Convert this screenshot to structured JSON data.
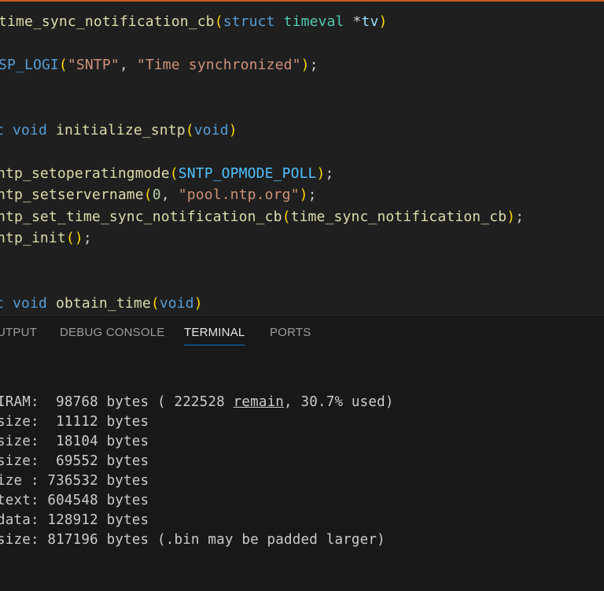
{
  "editor": {
    "lines": [
      {
        "parts": [
          {
            "t": "time_sync_notification_cb",
            "c": "tok-fn"
          },
          {
            "t": "(",
            "c": "tok-p1"
          },
          {
            "t": "struct",
            "c": "tok-kw"
          },
          {
            "t": " ",
            "c": "tok-punc"
          },
          {
            "t": "timeval",
            "c": "tok-type"
          },
          {
            "t": " *",
            "c": "tok-punc"
          },
          {
            "t": "tv",
            "c": "tok-var"
          },
          {
            "t": ")",
            "c": "tok-p1"
          }
        ]
      },
      {
        "parts": [
          {
            "t": "SP_LOGI",
            "c": "tok-kw"
          },
          {
            "t": "(",
            "c": "tok-p1"
          },
          {
            "t": "\"SNTP\"",
            "c": "tok-str"
          },
          {
            "t": ", ",
            "c": "tok-punc"
          },
          {
            "t": "\"Time synchronized\"",
            "c": "tok-str"
          },
          {
            "t": ")",
            "c": "tok-p1"
          },
          {
            "t": ";",
            "c": "tok-punc"
          }
        ]
      },
      {
        "parts": [
          {
            "t": "c",
            "c": "tok-kw"
          },
          {
            "t": " ",
            "c": "tok-punc"
          },
          {
            "t": "void",
            "c": "tok-kw"
          },
          {
            "t": " ",
            "c": "tok-punc"
          },
          {
            "t": "initialize_sntp",
            "c": "tok-fn"
          },
          {
            "t": "(",
            "c": "tok-p1"
          },
          {
            "t": "void",
            "c": "tok-kw"
          },
          {
            "t": ")",
            "c": "tok-p1"
          }
        ]
      },
      {
        "parts": [
          {
            "t": "ntp_setoperatingmode",
            "c": "tok-fn"
          },
          {
            "t": "(",
            "c": "tok-p1"
          },
          {
            "t": "SNTP_OPMODE_POLL",
            "c": "tok-const"
          },
          {
            "t": ")",
            "c": "tok-p1"
          },
          {
            "t": ";",
            "c": "tok-punc"
          }
        ]
      },
      {
        "parts": [
          {
            "t": "ntp_setservername",
            "c": "tok-fn"
          },
          {
            "t": "(",
            "c": "tok-p1"
          },
          {
            "t": "0",
            "c": "tok-num"
          },
          {
            "t": ", ",
            "c": "tok-punc"
          },
          {
            "t": "\"pool.ntp.org\"",
            "c": "tok-str"
          },
          {
            "t": ")",
            "c": "tok-p1"
          },
          {
            "t": ";",
            "c": "tok-punc"
          }
        ]
      },
      {
        "parts": [
          {
            "t": "ntp_set_time_sync_notification_cb",
            "c": "tok-fn"
          },
          {
            "t": "(",
            "c": "tok-p1"
          },
          {
            "t": "time_sync_notification_cb",
            "c": "tok-fn"
          },
          {
            "t": ")",
            "c": "tok-p1"
          },
          {
            "t": ";",
            "c": "tok-punc"
          }
        ]
      },
      {
        "parts": [
          {
            "t": "ntp_init",
            "c": "tok-fn"
          },
          {
            "t": "(",
            "c": "tok-p1"
          },
          {
            "t": ")",
            "c": "tok-p1"
          },
          {
            "t": ";",
            "c": "tok-punc"
          }
        ]
      },
      {
        "parts": [
          {
            "t": "c",
            "c": "tok-kw"
          },
          {
            "t": " ",
            "c": "tok-punc"
          },
          {
            "t": "void",
            "c": "tok-kw"
          },
          {
            "t": " ",
            "c": "tok-punc"
          },
          {
            "t": "obtain_time",
            "c": "tok-fn"
          },
          {
            "t": "(",
            "c": "tok-p1"
          },
          {
            "t": "void",
            "c": "tok-kw"
          },
          {
            "t": ")",
            "c": "tok-p1"
          }
        ]
      }
    ]
  },
  "panel": {
    "tabs": [
      {
        "label": "UTPUT",
        "active": false
      },
      {
        "label": "DEBUG CONSOLE",
        "active": false
      },
      {
        "label": "TERMINAL",
        "active": true
      },
      {
        "label": "PORTS",
        "active": false
      }
    ],
    "terminal": {
      "lines": [
        {
          "label": "IRAM:",
          "value": "  98768 bytes ( 222528 ",
          "ul": "remain",
          "tail": ", 30.7% used)"
        },
        {
          "label": "size:",
          "value": "  11112 bytes"
        },
        {
          "label": "size:",
          "value": "  18104 bytes"
        },
        {
          "label": "size:",
          "value": "  69552 bytes"
        },
        {
          "label": "ize :",
          "value": " 736532 bytes"
        },
        {
          "label": "text:",
          "value": " 604548 bytes"
        },
        {
          "label": "data:",
          "value": " 128912 bytes"
        },
        {
          "label": "size:",
          "value": " 817196 bytes (.bin may be padded larger)"
        }
      ]
    }
  },
  "colors": {
    "accent": "#0078d4",
    "window_border": "#c75b1e",
    "editor_bg": "#1f1f1f",
    "panel_bg": "#181818"
  }
}
